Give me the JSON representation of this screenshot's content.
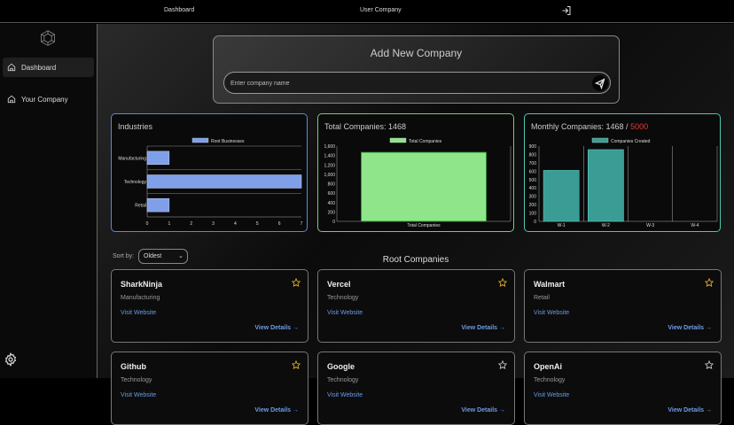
{
  "topbar": {
    "dashboard": "Dashboard",
    "user_company": "User Company",
    "logout_icon": "logout-icon"
  },
  "sidebar": {
    "items": [
      {
        "label": "Dashboard",
        "icon": "home-icon",
        "active": true
      },
      {
        "label": "Your Company",
        "icon": "home-icon",
        "active": false
      }
    ],
    "settings_icon": "gear-icon"
  },
  "add_company": {
    "title": "Add New Company",
    "placeholder": "Enter company name",
    "send_icon": "send-icon"
  },
  "charts": {
    "industries": {
      "title": "Industries",
      "border": "#5a87e0"
    },
    "total": {
      "title": "Total Companies: 1468",
      "border": "#6fcf7f"
    },
    "monthly": {
      "title_prefix": "Monthly Companies: 1468 / ",
      "limit": "5000",
      "limit_color": "#e23b3b",
      "border": "#4fc7b2"
    }
  },
  "chart_data": [
    {
      "type": "bar",
      "orientation": "horizontal",
      "categories": [
        "Manufacturing",
        "Technology",
        "Retail"
      ],
      "series": [
        {
          "name": "Root Businesses",
          "values": [
            1,
            7,
            1
          ]
        }
      ],
      "xlim": [
        0,
        7
      ],
      "xticks": [
        "0",
        "1",
        "2",
        "3",
        "4",
        "5",
        "6",
        "7"
      ],
      "color": "#7f9fe8"
    },
    {
      "type": "bar",
      "categories": [
        "Total Companies"
      ],
      "series": [
        {
          "name": "Total Companies",
          "values": [
            1468
          ]
        }
      ],
      "ylim": [
        0,
        1600
      ],
      "yticks": [
        "0",
        "200",
        "400",
        "600",
        "800",
        "1,000",
        "1,200",
        "1,400",
        "1,600"
      ],
      "color": "#8fe58a"
    },
    {
      "type": "bar",
      "categories": [
        "W-1",
        "W-2",
        "W-3",
        "W-4"
      ],
      "series": [
        {
          "name": "Companies Created",
          "values": [
            610,
            858,
            0,
            0
          ]
        }
      ],
      "ylim": [
        0,
        900
      ],
      "yticks": [
        "0",
        "100",
        "200",
        "300",
        "400",
        "500",
        "600",
        "700",
        "800",
        "900"
      ],
      "color": "#3a9c94"
    }
  ],
  "sort": {
    "label": "Sort by:",
    "selected": "Oldest"
  },
  "section_title": "Root Companies",
  "companies": [
    {
      "name": "SharkNinja",
      "industry": "Manufacturing",
      "visit": "Visit Website",
      "details": "View Details →"
    },
    {
      "name": "Vercel",
      "industry": "Technology",
      "visit": "Visit Website",
      "details": "View Details →"
    },
    {
      "name": "Walmart",
      "industry": "Retail",
      "visit": "Visit Website",
      "details": "View Details →"
    },
    {
      "name": "Github",
      "industry": "Technology",
      "visit": "Visit Website",
      "details": "View Details →"
    },
    {
      "name": "Google",
      "industry": "Technology",
      "visit": "Visit Website",
      "details": "View Details →"
    },
    {
      "name": "OpenAi",
      "industry": "Technology",
      "visit": "Visit Website",
      "details": "View Details →"
    }
  ]
}
